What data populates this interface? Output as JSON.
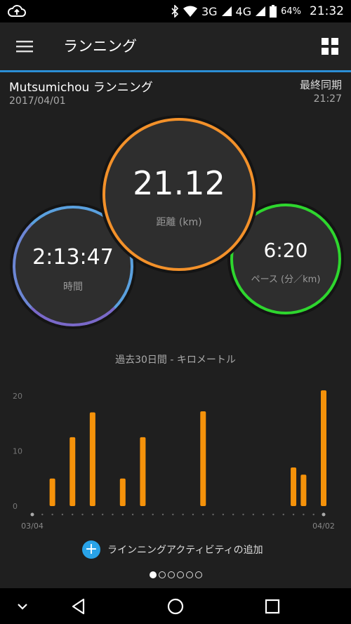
{
  "status_bar": {
    "cloud_icon": "cloud-sync-icon",
    "net_3g": "3G",
    "net_4g": "4G",
    "battery_pct": "64%",
    "time": "21:32"
  },
  "app_bar": {
    "title": "ランニング"
  },
  "activity": {
    "name": "Mutsumichou ランニング",
    "date": "2017/04/01",
    "sync_label": "最終同期",
    "sync_time": "21:27"
  },
  "stats": {
    "time": {
      "value": "2:13:47",
      "label": "時間"
    },
    "distance": {
      "value": "21.12",
      "label": "距離 (km)"
    },
    "pace": {
      "value": "6:20",
      "label": "ペース (分／km)"
    }
  },
  "colors": {
    "accent_blue": "#2b8ed6",
    "distance_ring": "#f3912a",
    "time_ring": "#5aa0de",
    "pace_ring": "#2ed62e",
    "bar": "#f5920a"
  },
  "chart_title": "過去30日間 - キロメートル",
  "chart_data": {
    "type": "bar",
    "ylim": [
      0,
      20
    ],
    "y_ticks": [
      "0",
      "10",
      "20"
    ],
    "x_start_label": "03/04",
    "x_end_label": "04/02",
    "values": [
      0,
      0,
      5,
      0,
      12.5,
      0,
      17,
      0,
      0,
      5,
      0,
      12.5,
      0,
      0,
      0,
      0,
      0,
      17.2,
      0,
      0,
      0,
      0,
      0,
      0,
      0,
      0,
      7,
      5.7,
      0,
      21
    ],
    "grid": false
  },
  "add_activity": {
    "label": "ラインニングアクティビティの追加"
  },
  "pager": {
    "count": 6,
    "active": 0
  }
}
